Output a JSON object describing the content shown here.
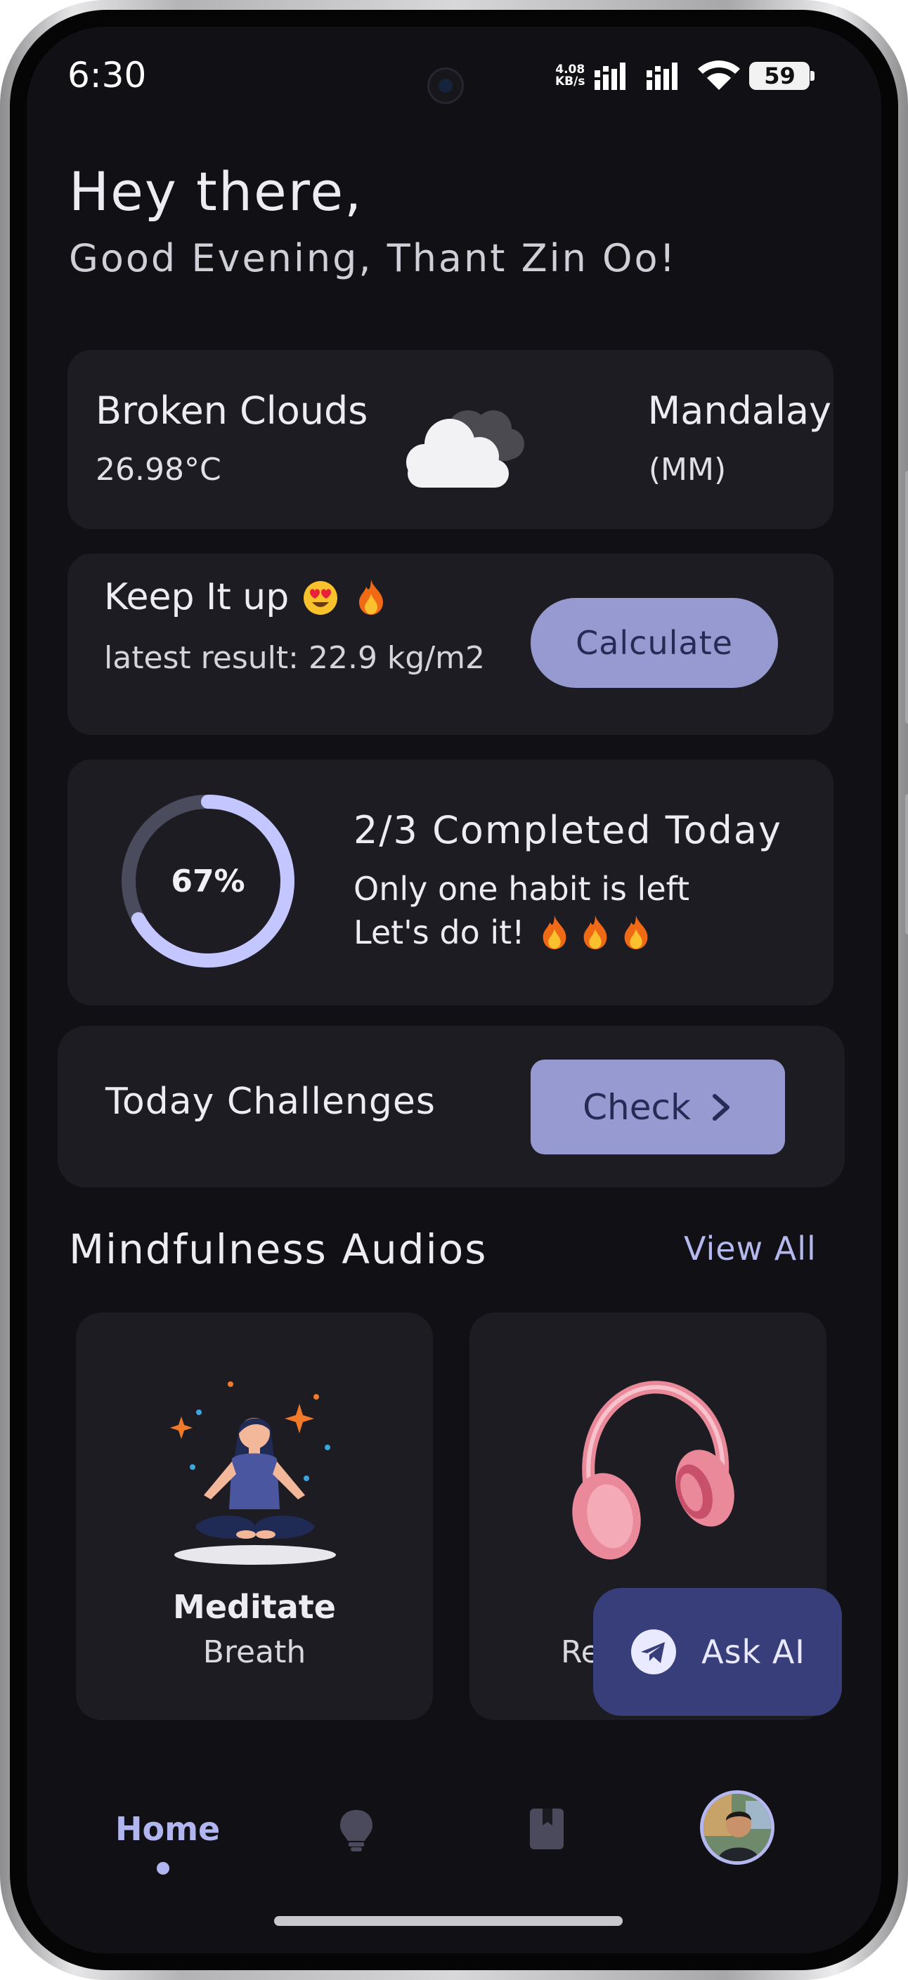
{
  "status_bar": {
    "time": "6:30",
    "net_speed_value": "4.08",
    "net_speed_unit": "KB/s",
    "battery": "59",
    "icons": [
      "signal-icon",
      "signal-icon",
      "wifi-icon",
      "battery-icon"
    ]
  },
  "greeting": {
    "title": "Hey there,",
    "subtitle": "Good Evening, Thant Zin Oo!"
  },
  "weather": {
    "condition": "Broken Clouds",
    "temperature": "26.98°C",
    "city": "Mandalay",
    "country": "(MM)",
    "icon": "cloud-icon"
  },
  "bmi": {
    "title": "Keep It up",
    "latest_result": "latest result: 22.9 kg/m2",
    "button_label": "Calculate",
    "emoji_icons": [
      "heart-eyes-emoji-icon",
      "fire-emoji-icon"
    ]
  },
  "habits": {
    "progress_label": "67%",
    "progress_fraction": 0.67,
    "title": "2/3 Completed Today",
    "line1": "Only one habit is left",
    "line2": "Let's do it!",
    "emoji_icons": [
      "fire-emoji-icon",
      "fire-emoji-icon",
      "fire-emoji-icon"
    ]
  },
  "challenges": {
    "title": "Today Challenges",
    "button_label": "Check"
  },
  "mindfulness": {
    "title": "Mindfulness Audios",
    "view_all": "View All",
    "audios": [
      {
        "title": "Meditate",
        "subtitle": "Breath"
      },
      {
        "subtitle_partial": "Re"
      }
    ]
  },
  "fab": {
    "label": "Ask AI",
    "icon": "telegram-icon"
  },
  "bottom_nav": {
    "home_label": "Home",
    "items": [
      "home",
      "lightbulb-icon",
      "book-icon",
      "profile-avatar"
    ]
  },
  "colors": {
    "background": "#111115",
    "card": "#1d1c22",
    "accent": "#969ad0",
    "accent_text": "#262a55",
    "link": "#b5b8ee",
    "fab": "#373e7a",
    "ring_track": "#4a4b5c",
    "ring_fill": "#c4c6ff"
  }
}
